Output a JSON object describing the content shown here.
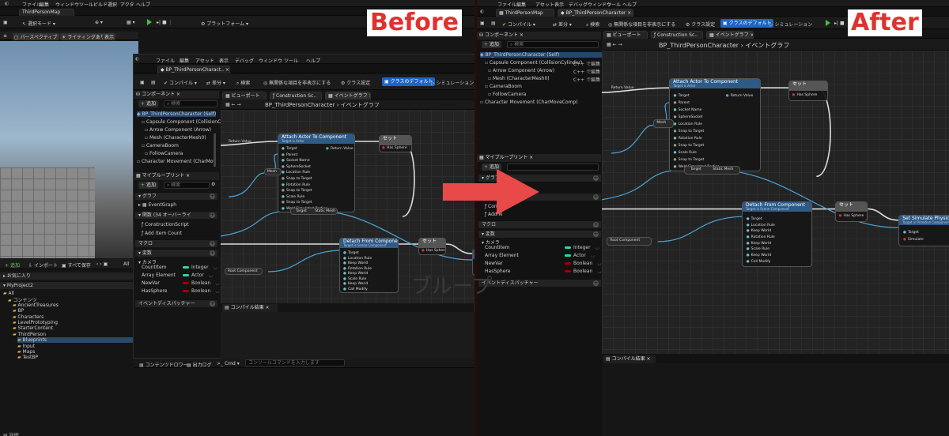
{
  "left": {
    "window_tab": "ThirdPersonMap",
    "menu": [
      "ファイル",
      "編集",
      "ウィンドウ",
      "ツール",
      "ビルド",
      "選択",
      "アクタ",
      "ヘルプ"
    ],
    "toolbar": {
      "mode": "選択モード",
      "platform": "プラットフォーム"
    },
    "viewport": {
      "perspective": "パースペクティブ",
      "lighting": "ライティングあり",
      "show": "表示"
    },
    "bottom_toolbar": {
      "add": "追加",
      "import": "インポート",
      "save_all": "すべて保存",
      "all": "All"
    },
    "favorites": "お気に入り",
    "project": "MyProject2",
    "tree": [
      "All",
      "コンテンツ",
      "AncientTreasures",
      "BP",
      "Characters",
      "LevelPrototyping",
      "StarterContent",
      "ThirdPerson",
      "Blueprints",
      "Input",
      "Maps",
      "TestBP"
    ],
    "statusbar": {
      "content_drawer": "コンテンツドロワー",
      "output_log": "出力ログ",
      "cmd": "Cmd",
      "cmd_placeholder": "コンソールコマンドを入力します"
    },
    "bottom_label": "詳細"
  },
  "bp_left": {
    "menu": [
      "ファイル",
      "編集",
      "アセット",
      "表示",
      "デバッグ",
      "ウィンドウ",
      "ツール",
      "ヘルプ"
    ],
    "tab": "BP_ThirdPersonCharact..",
    "toolbar": {
      "compile": "コンパイル",
      "diff": "差分",
      "search": "検索",
      "hide": "無関係な項目を非表示にする",
      "class_settings": "クラス設定",
      "class_defaults": "クラスのデフォルト",
      "simulation": "シミュレーション"
    },
    "components": {
      "header": "コンポーネント",
      "add": "追加",
      "search": "検索",
      "items": [
        "BP_ThirdPersonCharacter (Self)",
        "Capsule Component (CollisionCy",
        "Arrow Component (Arrow)",
        "Mesh (CharacterMesh0)",
        "CameraBoom",
        "FollowCamera",
        "Character Movement (CharMov"
      ]
    },
    "my_blueprint": {
      "header": "マイブループリント",
      "add": "追加",
      "search": "検索"
    },
    "sections": {
      "graph": "グラフ",
      "event_graph": "EventGraph",
      "functions": "関数 (34 オーバーライ",
      "construction": "ConstructionScript",
      "add_count": "Add Item Count",
      "macro": "マクロ",
      "variables": "変数",
      "camera": "カメラ",
      "dispatchers": "イベントディスパッチャー"
    },
    "vars": [
      {
        "name": "CountItem",
        "type": "Integer",
        "color": "#2bd9a7"
      },
      {
        "name": "Array Element",
        "type": "Actor",
        "color": "#2bd9a7"
      },
      {
        "name": "NewVar",
        "type": "Boolean",
        "color": "#a00000"
      },
      {
        "name": "HasSphere",
        "type": "Boolean",
        "color": "#a00000"
      }
    ],
    "graph_tabs": {
      "viewport": "ビューポート",
      "construction": "Construction Sc..",
      "event_graph": "イベントグラフ"
    },
    "breadcrumb": {
      "bp": "BP_ThirdPersonCharacter",
      "sep": "›",
      "graph": "イベントグラフ"
    },
    "compile_results": "コンパイル結果",
    "watermark": "ブループ"
  },
  "right": {
    "menu": [
      "ファイル",
      "編集",
      "アセット",
      "表示",
      "デバッグ",
      "ウィンドウ",
      "ツール",
      "ヘルプ"
    ],
    "tab_map": "ThirdPersonMap",
    "tab_bp": "BP_ThirdPersonCharacter",
    "toolbar": {
      "compile": "コンパイル",
      "diff": "差分",
      "search": "検索",
      "hide": "無関係な項目を非表示にする",
      "class_settings": "クラス設定",
      "class_defaults": "クラスのデフォルト",
      "simulation": "シミュレーション"
    },
    "components": {
      "header": "コンポーネント",
      "add": "追加",
      "search": "検索",
      "items": [
        "BP_ThirdPersonCharacter (Self)",
        "Capsule Component (CollisionCylinder)",
        "Arrow Component (Arrow)",
        "Mesh (CharacterMesh0)",
        "CameraBoom",
        "FollowCamera",
        "Character Movement (CharMoveComp)"
      ],
      "edit_label": "C++ で編集"
    },
    "my_blueprint": {
      "header": "マイブループリント",
      "add": "追加"
    },
    "sections": {
      "graph": "グラフ",
      "construction": "Constr",
      "add_count": "Add N",
      "macro": "マクロ",
      "variables": "変数",
      "camera": "カメラ",
      "dispatchers": "イベントディスパッチャー"
    },
    "vars": [
      {
        "name": "CountItem",
        "type": "Integer",
        "color": "#2bd9a7"
      },
      {
        "name": "Array Element",
        "type": "Actor",
        "color": "#2bd9a7"
      },
      {
        "name": "NewVar",
        "type": "Boolean",
        "color": "#a00000"
      },
      {
        "name": "HasSphere",
        "type": "Boolean",
        "color": "#a00000"
      }
    ],
    "graph_tabs": {
      "viewport": "ビューポート",
      "construction": "Construction Sc..",
      "event_graph": "イベントグラフ"
    },
    "breadcrumb": {
      "bp": "BP_ThirdPersonCharacter",
      "sep": "›",
      "graph": "イベントグラフ"
    },
    "compile_results": "コンパイル結果"
  },
  "nodes": {
    "attach": {
      "title": "Attach Actor To Component",
      "sub": "Target is Actor",
      "pins": [
        "Target",
        "Parent",
        "Socket Name",
        "SphereSocket",
        "Location Rule",
        "Snap to Target",
        "Rotation Rule",
        "Snap to Target",
        "Scale Rule",
        "Snap to Target",
        "Weld Simulated Bodies"
      ],
      "ret": "Return Value"
    },
    "set1": {
      "title": "セット",
      "pin": "Has Sphere"
    },
    "detach": {
      "title": "Detach From Component",
      "sub": "Target is Scene Component",
      "pins": [
        "Target",
        "Location Rule",
        "Keep World",
        "Rotation Rule",
        "Keep World",
        "Scale Rule",
        "Keep World",
        "Call Modify"
      ]
    },
    "set2": {
      "title": "セット",
      "pin": "Has Sphere"
    },
    "physics": {
      "title": "Set Simulate Physics",
      "sub": "Target is Primitive Component",
      "pins": [
        "Target",
        "Simulate"
      ]
    },
    "mesh": "Mesh",
    "target": "Target",
    "static_mesh": "Static Mesh",
    "root": "Root Component",
    "return_value": "Return Value"
  },
  "labels": {
    "before": "Before",
    "after": "After"
  },
  "colors": {
    "accent_blue": "#1c64c8",
    "exec_red": "#e84a4a",
    "label_red": "#e0312f",
    "node_blue": "#2e5a86",
    "node_green": "#2f6a5a",
    "node_gray": "#555555"
  }
}
